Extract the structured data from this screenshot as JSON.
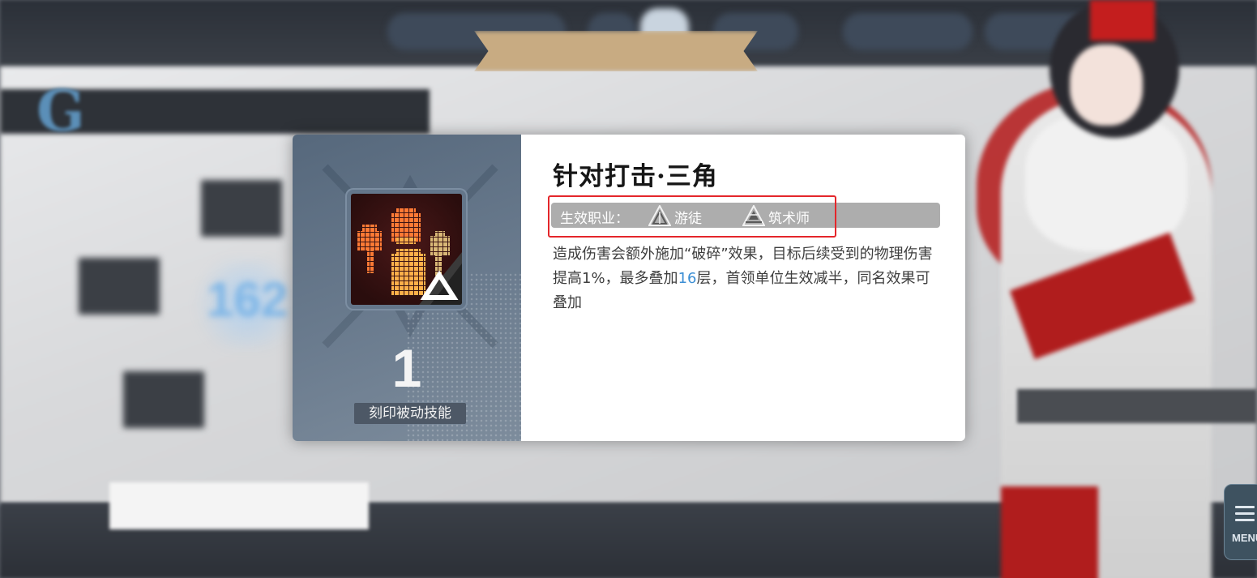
{
  "skill": {
    "title": "针对打击·三角",
    "level": "1",
    "type_label": "刻印被动技能",
    "jobs_label": "生效职业：",
    "jobs": [
      {
        "icon": "wanderer-class-icon",
        "name": "游徒"
      },
      {
        "icon": "architect-class-icon",
        "name": "筑术师"
      }
    ],
    "description": {
      "part1": "造成伤害会额外施加“破碎”效果，目标后续受到的物理伤害提高1%，最多叠加",
      "stacks": "16",
      "part2": "层，首领单位生效减半，同名效果可叠加"
    }
  },
  "menu": {
    "label": "MENU"
  },
  "colors": {
    "highlight_border": "#e4262b",
    "stack_number": "#3b8ed4",
    "panel_left": "#5f7185",
    "job_bar": "#adadad"
  }
}
